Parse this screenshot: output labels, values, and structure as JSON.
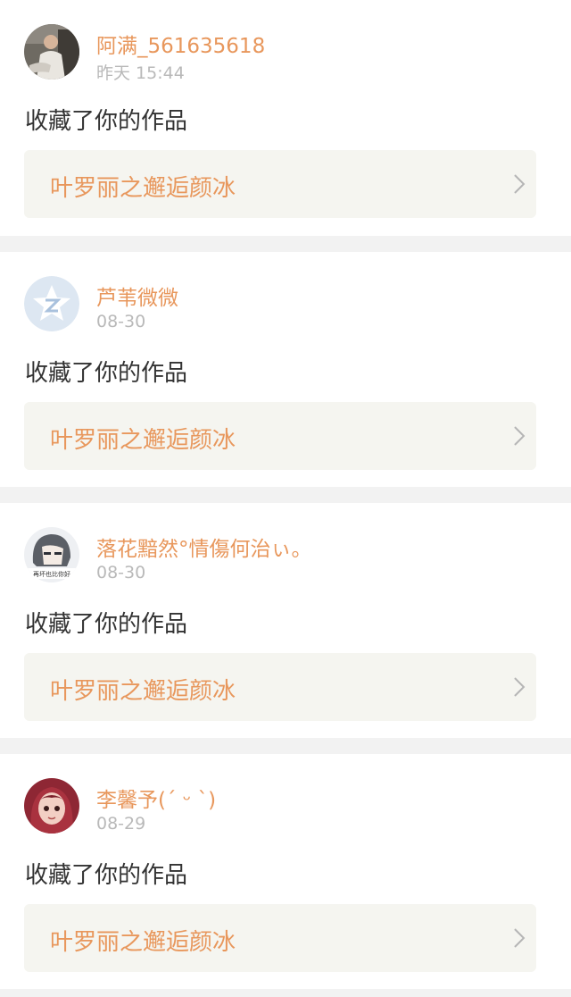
{
  "notifications": [
    {
      "user": "阿满_561635618",
      "time": "昨天 15:44",
      "action": "收藏了你的作品",
      "work_title": "叶罗丽之邂逅颜冰",
      "avatar": "photo-avatar-icon"
    },
    {
      "user": "芦苇微微",
      "time": "08-30",
      "action": "收藏了你的作品",
      "work_title": "叶罗丽之邂逅颜冰",
      "avatar": "default-star-avatar-icon"
    },
    {
      "user": "落花黯然°情傷何治ぃ。",
      "time": "08-30",
      "action": "收藏了你的作品",
      "work_title": "叶罗丽之邂逅颜冰",
      "avatar": "anime-avatar-icon",
      "avatar_caption": "再坏也比你好"
    },
    {
      "user": "李馨予(ˊ ᵕ ˋ)",
      "time": "08-29",
      "action": "收藏了你的作品",
      "work_title": "叶罗丽之邂逅颜冰",
      "avatar": "cartoon-girl-avatar-icon"
    }
  ],
  "colors": {
    "accent": "#e8975c",
    "muted": "#b9b9b9",
    "text": "#333333",
    "card_bg": "#ffffff",
    "page_bg": "#f2f2f2",
    "link_bg": "#f5f5f0"
  }
}
